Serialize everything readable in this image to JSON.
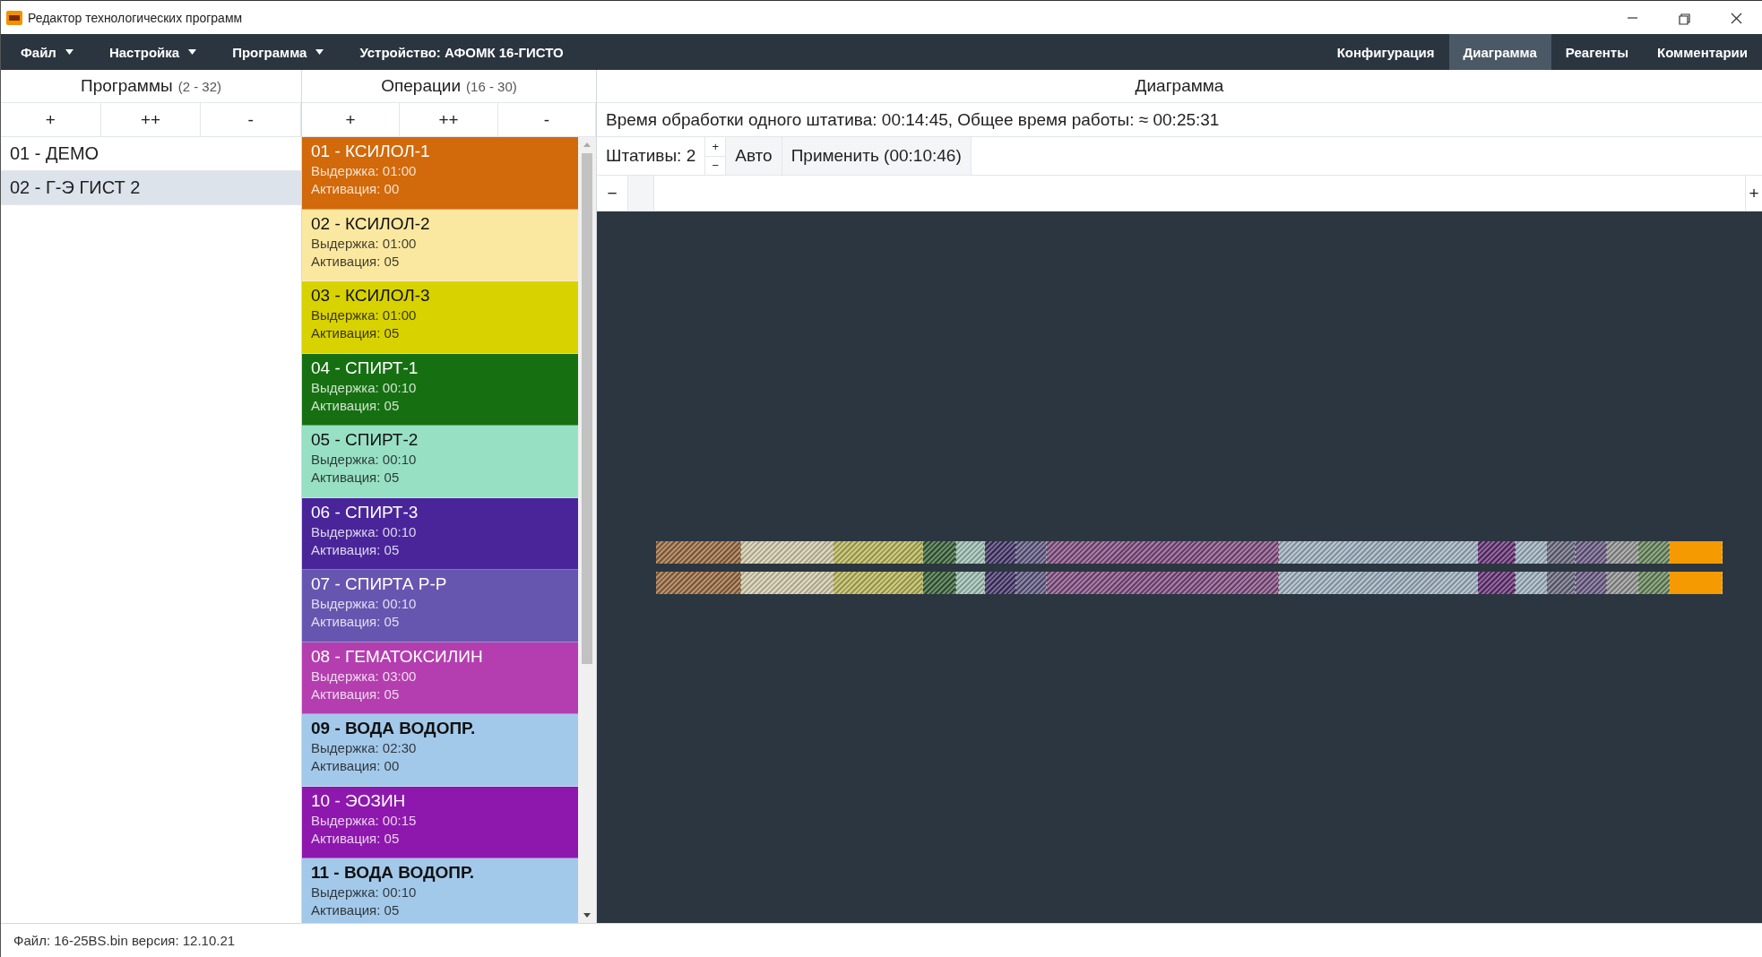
{
  "window": {
    "title": "Редактор технологических программ"
  },
  "menu": [
    {
      "label": "Файл",
      "dropdown": true
    },
    {
      "label": "Настройка",
      "dropdown": true
    },
    {
      "label": "Программа",
      "dropdown": true
    },
    {
      "label": "Устройство: АФОМК 16-ГИСТО",
      "dropdown": false
    }
  ],
  "tabs": [
    {
      "label": "Конфигурация",
      "selected": false
    },
    {
      "label": "Диаграмма",
      "selected": true
    },
    {
      "label": "Реагенты",
      "selected": false
    },
    {
      "label": "Комментарии",
      "selected": false
    }
  ],
  "programs": {
    "title": "Программы",
    "count": "(2 - 32)",
    "buttons": [
      "+",
      "++",
      "-"
    ],
    "items": [
      {
        "label": "01 - ДЕМО",
        "selected": false
      },
      {
        "label": "02 - Г-Э ГИСТ 2",
        "selected": true
      }
    ]
  },
  "operations": {
    "title": "Операции",
    "count": "(16 - 30)",
    "buttons": [
      "+",
      "++",
      "-"
    ],
    "items": [
      {
        "name": "01 - КСИЛОЛ-1",
        "hold": "Выдержка: 01:00",
        "activation": "Активация: 00",
        "color": "#d2690a",
        "bold": false
      },
      {
        "name": "02 - КСИЛОЛ-2",
        "hold": "Выдержка: 01:00",
        "activation": "Активация: 05",
        "color": "#fbe8a0",
        "bold": false
      },
      {
        "name": "03 - КСИЛОЛ-3",
        "hold": "Выдержка: 01:00",
        "activation": "Активация: 05",
        "color": "#d8d200",
        "bold": false
      },
      {
        "name": "04 - СПИРТ-1",
        "hold": "Выдержка: 00:10",
        "activation": "Активация: 05",
        "color": "#167012",
        "bold": false
      },
      {
        "name": "05 - СПИРТ-2",
        "hold": "Выдержка: 00:10",
        "activation": "Активация: 05",
        "color": "#97e0c4",
        "bold": false
      },
      {
        "name": "06 - СПИРТ-3",
        "hold": "Выдержка: 00:10",
        "activation": "Активация: 05",
        "color": "#4a259a",
        "bold": false
      },
      {
        "name": "07 - СПИРТА Р-Р",
        "hold": "Выдержка: 00:10",
        "activation": "Активация: 05",
        "color": "#6656b0",
        "bold": false
      },
      {
        "name": "08 - ГЕМАТОКСИЛИН",
        "hold": "Выдержка: 03:00",
        "activation": "Активация: 05",
        "color": "#b43eaf",
        "bold": false
      },
      {
        "name": "09 - ВОДА ВОДОПР.",
        "hold": "Выдержка: 02:30",
        "activation": "Активация: 00",
        "color": "#a3c9ea",
        "bold": true
      },
      {
        "name": "10 - ЭОЗИН",
        "hold": "Выдержка: 00:15",
        "activation": "Активация: 05",
        "color": "#8e18ad",
        "bold": false
      },
      {
        "name": "11 - ВОДА ВОДОПР.",
        "hold": "Выдержка: 00:10",
        "activation": "Активация: 05",
        "color": "#a3c9ea",
        "bold": true
      }
    ]
  },
  "diagram": {
    "title": "Диаграмма",
    "summary": "Время обработки одного штатива: 00:14:45, Общее время работы: ≈ 00:25:31",
    "racks_label": "Штативы: 2",
    "stepper": [
      "+",
      "−"
    ],
    "auto_button": "Авто",
    "apply_button": "Применить (00:10:46)",
    "zoom_out": "−",
    "zoom_in": "+"
  },
  "status_bar": "Файл: 16-25BS.bin версия: 12.10.21"
}
